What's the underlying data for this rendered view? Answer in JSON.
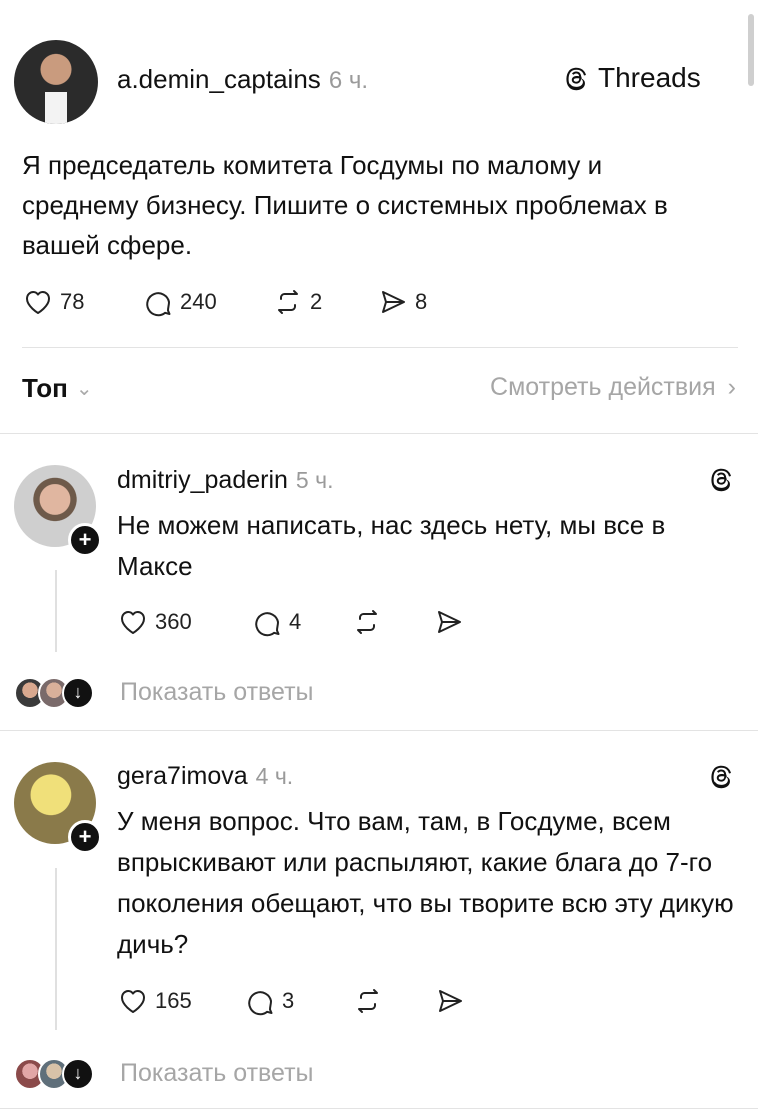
{
  "post": {
    "author": "a.demin_captains",
    "time": "6 ч.",
    "app_badge": "Threads",
    "text": "Я председатель комитета Госдумы по малому и среднему бизнесу. Пишите о системных проблемах в вашей сфере.",
    "likes": "78",
    "replies": "240",
    "reposts": "2",
    "shares": "8"
  },
  "sort": {
    "label": "Топ",
    "view_activity": "Смотреть действия"
  },
  "comments": [
    {
      "author": "dmitriy_paderin",
      "time": "5 ч.",
      "text": "Не можем написать, нас здесь нету, мы все в Максе",
      "likes": "360",
      "replies": "4",
      "show_replies": "Показать ответы"
    },
    {
      "author": "gera7imova",
      "time": "4 ч.",
      "text": "У меня вопрос. Что вам, там, в Госдуме, всем впрыскивают или распыляют, какие блага до 7-го поколения обещают, что вы творите всю эту дикую дичь?",
      "likes": "165",
      "replies": "3",
      "show_replies": "Показать ответы"
    }
  ],
  "icons": {
    "like": "heart-icon",
    "reply": "comment-bubble-icon",
    "repost": "repost-icon",
    "share": "send-icon",
    "threads": "threads-logo-icon",
    "follow": "plus-icon"
  },
  "colors": {
    "text": "#111111",
    "muted": "#a6a6a6",
    "divider": "#e3e3e3",
    "background": "#ffffff"
  }
}
